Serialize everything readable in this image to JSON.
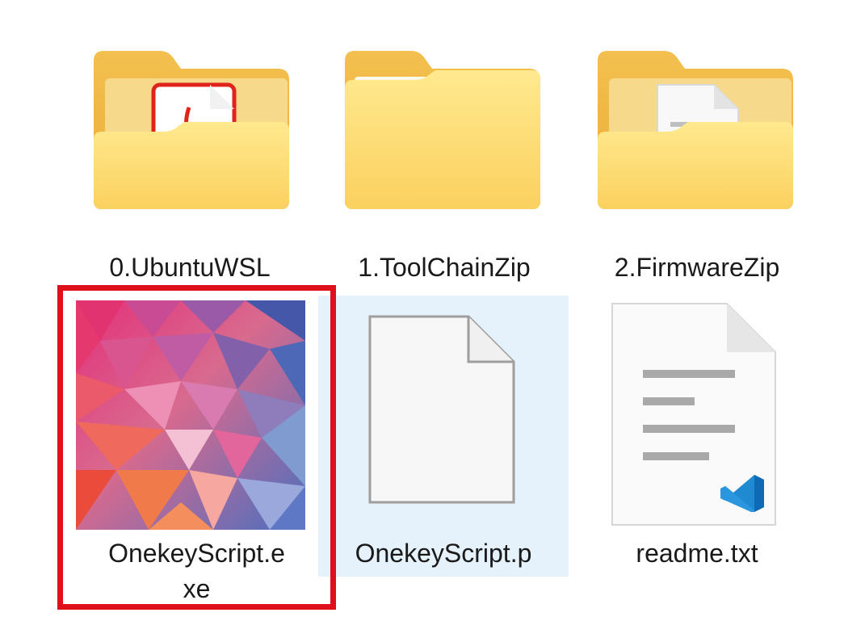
{
  "items": [
    {
      "name": "0.UbuntuWSL",
      "icon": "folder-with-pdf-icon",
      "type": "folder"
    },
    {
      "name": "1.ToolChainZip",
      "icon": "folder-icon",
      "type": "folder"
    },
    {
      "name": "2.FirmwareZip",
      "icon": "folder-with-document-icon",
      "type": "folder"
    },
    {
      "name_line1": "OnekeyScript.e",
      "name_line2": "xe",
      "icon": "exe-app-icon",
      "type": "file"
    },
    {
      "name": "OnekeyScript.p",
      "icon": "blank-file-icon",
      "type": "file",
      "selected": true
    },
    {
      "name": "readme.txt",
      "icon": "vscode-text-file-icon",
      "type": "file"
    }
  ],
  "colors": {
    "highlight_border": "#e0101a",
    "selection_bg": "#e5f1fb",
    "folder_light": "#fde58a",
    "folder_dark": "#f4c24b"
  }
}
